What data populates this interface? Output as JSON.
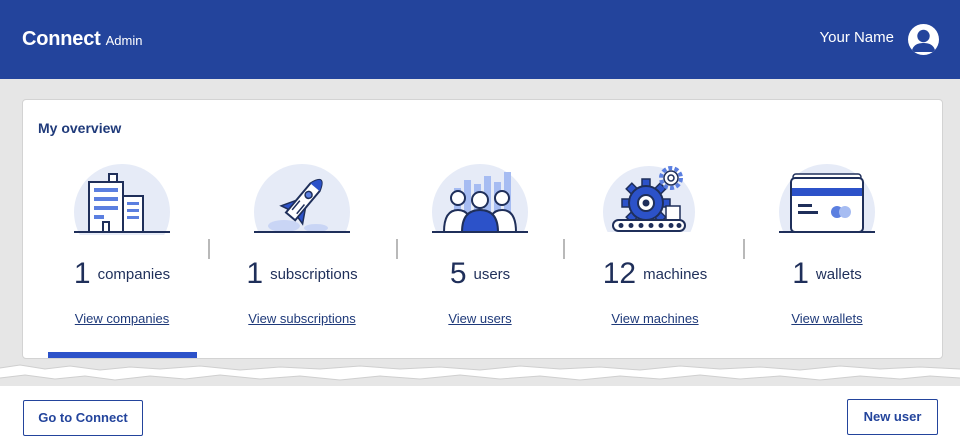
{
  "header": {
    "brand": "Connect",
    "brand_sub": "Admin",
    "user_name": "Your Name",
    "avatar_icon": "user-avatar-icon"
  },
  "overview": {
    "title": "My overview",
    "stats": [
      {
        "value": "1",
        "unit": "companies",
        "link": "View companies",
        "icon": "buildings-icon"
      },
      {
        "value": "1",
        "unit": "subscriptions",
        "link": "View subscriptions",
        "icon": "rocket-icon"
      },
      {
        "value": "5",
        "unit": "users",
        "link": "View users",
        "icon": "users-group-icon"
      },
      {
        "value": "12",
        "unit": "machines",
        "link": "View machines",
        "icon": "gears-conveyor-icon"
      },
      {
        "value": "1",
        "unit": "wallets",
        "link": "View wallets",
        "icon": "credit-card-icon"
      }
    ]
  },
  "footer": {
    "go_to_connect": "Go to Connect",
    "new_user": "New user"
  },
  "colors": {
    "brand_blue": "#23449c",
    "accent_blue": "#2c52c9",
    "light_blue": "#e6ebf7",
    "text_dark": "#1f2f5a"
  }
}
